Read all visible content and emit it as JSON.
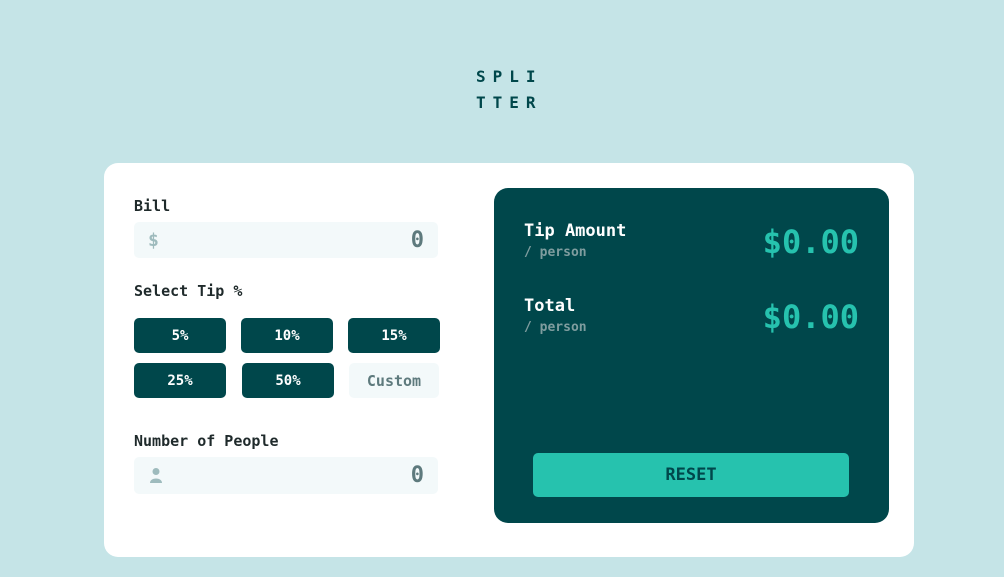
{
  "logo": {
    "line1": "SPLI",
    "line2": "TTER"
  },
  "bill": {
    "label": "Bill",
    "currency_symbol": "$",
    "value": "0"
  },
  "tip": {
    "label": "Select Tip %",
    "options": [
      "5%",
      "10%",
      "15%",
      "25%",
      "50%"
    ],
    "custom_placeholder": "Custom"
  },
  "people": {
    "label": "Number of People",
    "value": "0",
    "icon": "person-icon"
  },
  "results": {
    "tip_amount": {
      "title": "Tip Amount",
      "sub": "/ person",
      "value": "$0.00"
    },
    "total": {
      "title": "Total",
      "sub": "/ person",
      "value": "$0.00"
    },
    "reset_label": "RESET"
  },
  "colors": {
    "background": "#c5e4e7",
    "dark_cyan": "#00474b",
    "accent": "#26c2ae",
    "input_bg": "#f3f9fa"
  }
}
